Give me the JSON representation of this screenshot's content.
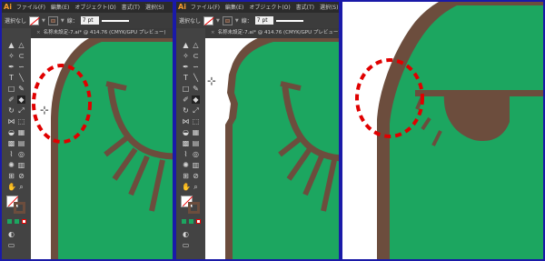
{
  "menu": {
    "logo": "Ai",
    "items": [
      "ファイル(F)",
      "編集(E)",
      "オブジェクト(O)",
      "書式(T)",
      "選択(S)"
    ]
  },
  "control": {
    "selection": "選択なし",
    "stroke_label": "線：",
    "stroke_value": "7 pt"
  },
  "document": {
    "tab_title": "名称未設定-7.ai* @ 414.76 (CMYK/GPU プレビュー)"
  },
  "colors": {
    "frame_border": "#1a1aa8",
    "shape_green": "#1ca660",
    "outline_brown": "#6c4d3d",
    "highlight_red": "#e00000",
    "artboard_white": "#ffffff"
  },
  "icons": [
    "eraser-icon",
    "crosshair-cursor-icon",
    "fill-none-icon",
    "stroke-swatch-icon"
  ]
}
